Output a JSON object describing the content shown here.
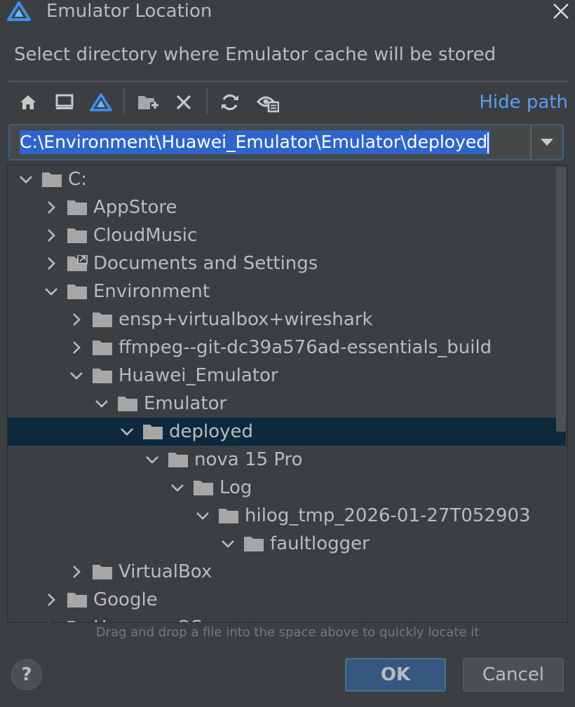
{
  "window": {
    "title": "Emulator Location",
    "logo_icon": "deveco-logo-icon",
    "close_icon": "close-icon"
  },
  "description": "Select directory where Emulator cache will be stored",
  "toolbar": {
    "buttons": [
      {
        "name": "home-icon",
        "tooltip": ""
      },
      {
        "name": "desktop-icon",
        "tooltip": ""
      },
      {
        "name": "project-icon",
        "tooltip": ""
      },
      {
        "name": "new-folder-icon",
        "tooltip": ""
      },
      {
        "name": "delete-icon",
        "tooltip": ""
      },
      {
        "name": "refresh-icon",
        "tooltip": ""
      },
      {
        "name": "show-hidden-icon",
        "tooltip": ""
      }
    ],
    "hide_path_label": "Hide path"
  },
  "path_field": {
    "value": "C:\\Environment\\Huawei_Emulator\\Emulator\\deployed"
  },
  "tree": {
    "nodes": [
      {
        "label": "C:",
        "depth": 0,
        "expanded": true,
        "selected": false,
        "special": false
      },
      {
        "label": "AppStore",
        "depth": 1,
        "expanded": false,
        "selected": false,
        "special": false
      },
      {
        "label": "CloudMusic",
        "depth": 1,
        "expanded": false,
        "selected": false,
        "special": false
      },
      {
        "label": "Documents and Settings",
        "depth": 1,
        "expanded": false,
        "selected": false,
        "special": true
      },
      {
        "label": "Environment",
        "depth": 1,
        "expanded": true,
        "selected": false,
        "special": false
      },
      {
        "label": "ensp+virtualbox+wireshark",
        "depth": 2,
        "expanded": false,
        "selected": false,
        "special": false
      },
      {
        "label": "ffmpeg--git-dc39a576ad-essentials_build",
        "depth": 2,
        "expanded": false,
        "selected": false,
        "special": false
      },
      {
        "label": "Huawei_Emulator",
        "depth": 2,
        "expanded": true,
        "selected": false,
        "special": false
      },
      {
        "label": "Emulator",
        "depth": 3,
        "expanded": true,
        "selected": false,
        "special": false
      },
      {
        "label": "deployed",
        "depth": 4,
        "expanded": true,
        "selected": true,
        "special": false
      },
      {
        "label": "nova 15 Pro",
        "depth": 5,
        "expanded": true,
        "selected": false,
        "special": false
      },
      {
        "label": "Log",
        "depth": 6,
        "expanded": true,
        "selected": false,
        "special": false
      },
      {
        "label": "hilog_tmp_2026-01-27T052903",
        "depth": 7,
        "expanded": true,
        "selected": false,
        "special": false
      },
      {
        "label": "faultlogger",
        "depth": 8,
        "expanded": true,
        "selected": false,
        "special": false
      },
      {
        "label": "VirtualBox",
        "depth": 2,
        "expanded": false,
        "selected": false,
        "special": false
      },
      {
        "label": "Google",
        "depth": 1,
        "expanded": false,
        "selected": false,
        "special": false
      },
      {
        "label": "HarmonyOS",
        "depth": 1,
        "expanded": false,
        "selected": false,
        "special": false
      }
    ]
  },
  "drag_hint": "Drag and drop a file into the space above to quickly locate it",
  "buttons": {
    "help": "?",
    "ok": "OK",
    "cancel": "Cancel"
  },
  "colors": {
    "background": "#3c3f41",
    "accent_link": "#589df6",
    "selection": "#0d293e",
    "path_highlight": "#2f65ca",
    "ok_button": "#365880"
  }
}
